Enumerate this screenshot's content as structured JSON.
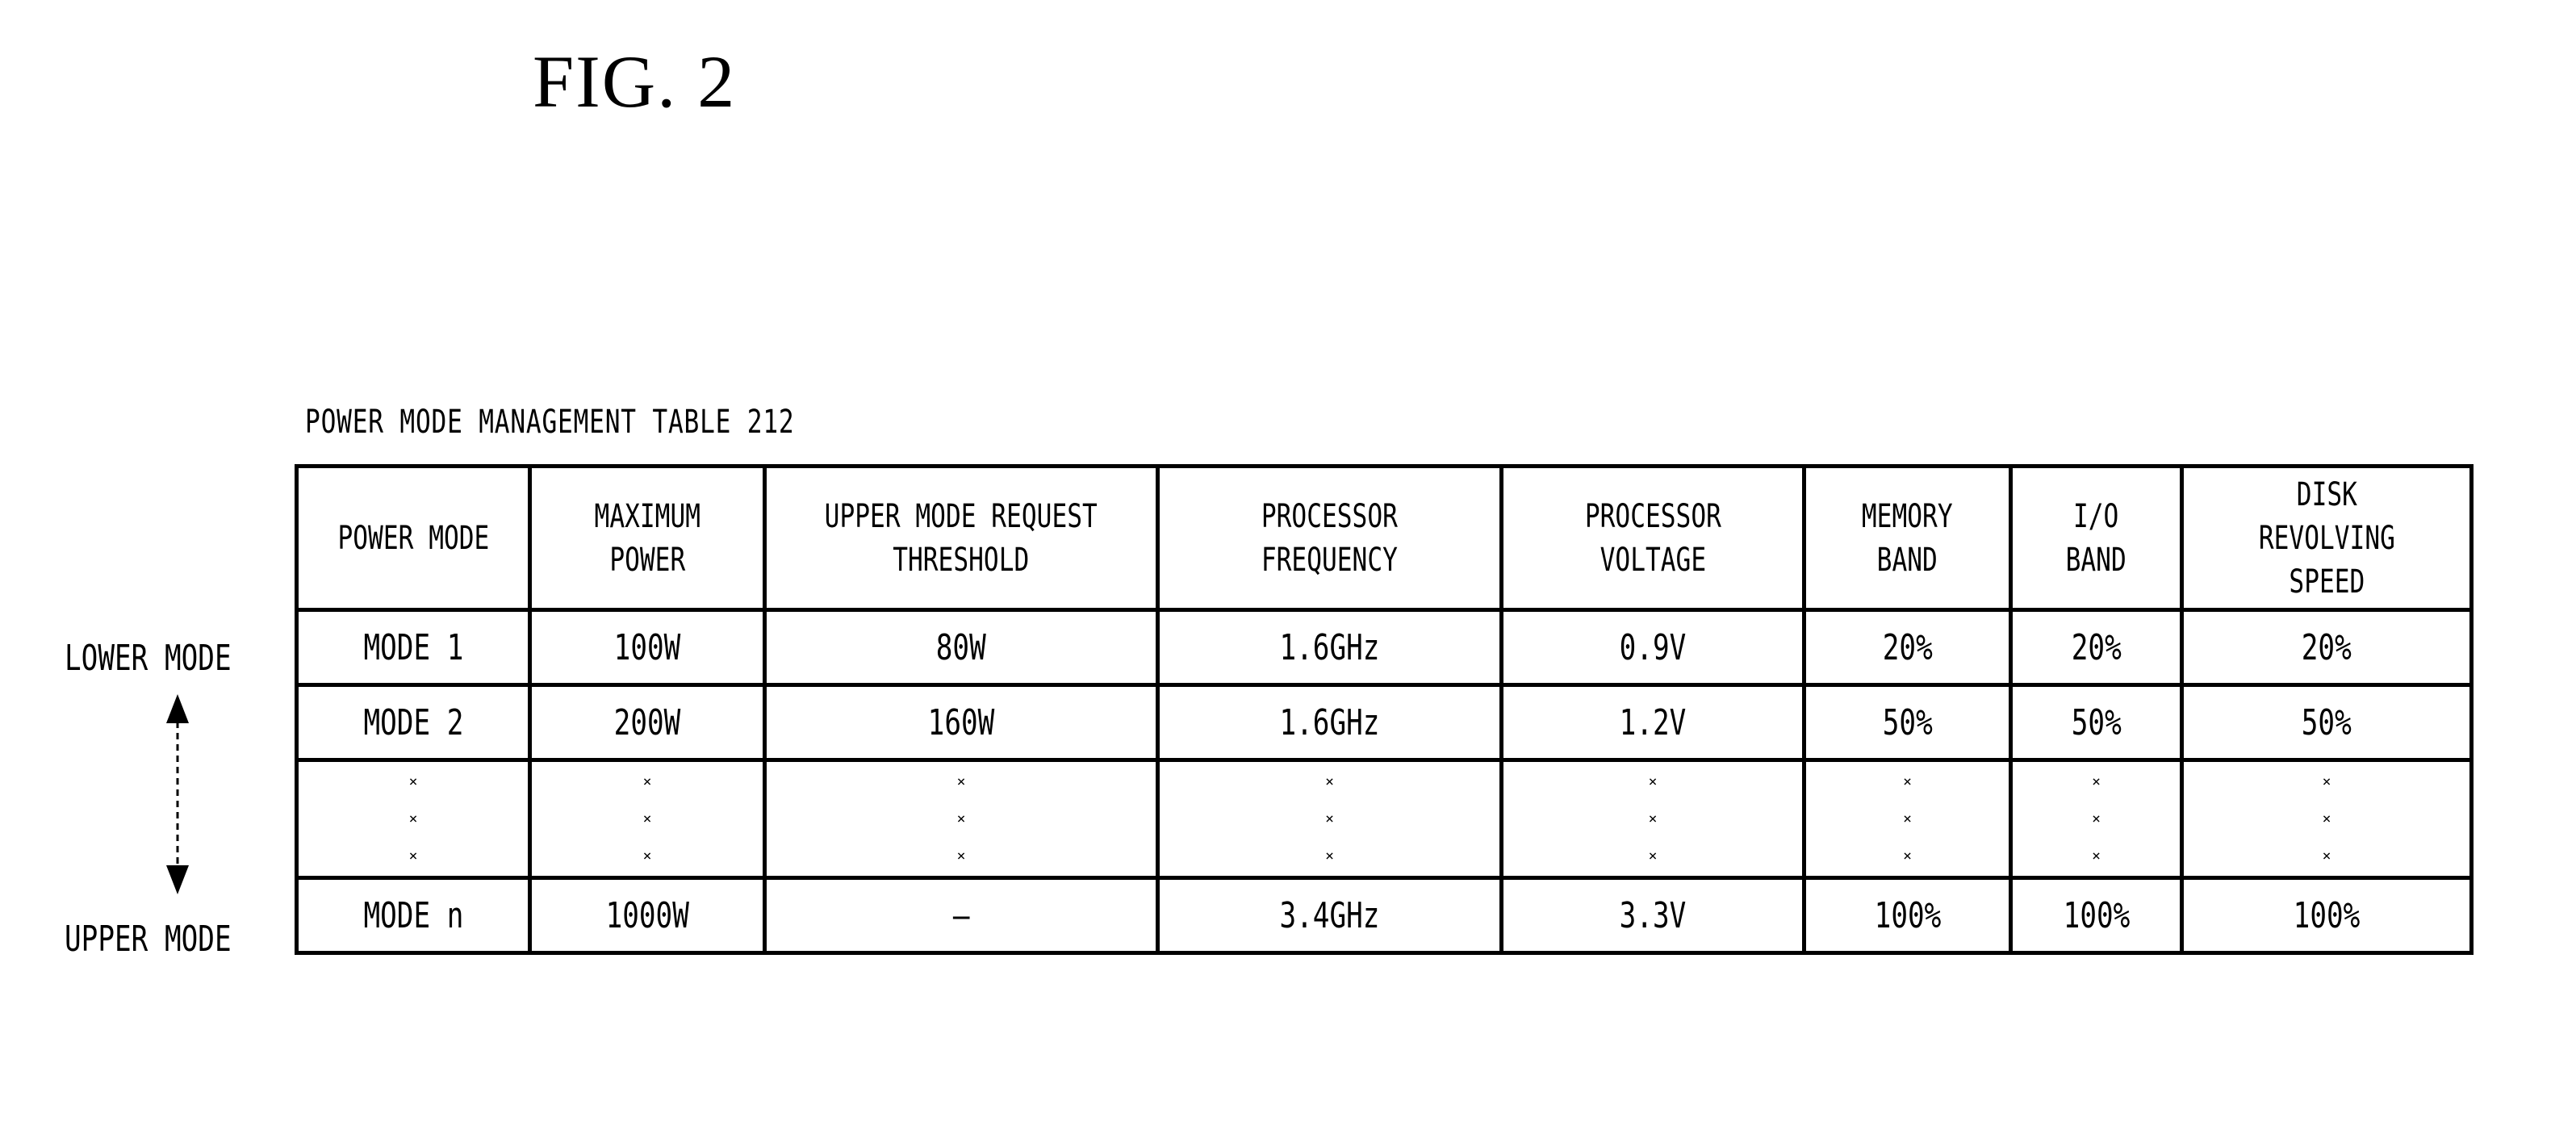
{
  "figure": {
    "title": "FIG. 2"
  },
  "table": {
    "caption": "POWER MODE MANAGEMENT TABLE 212",
    "columns": [
      "POWER MODE",
      "MAXIMUM\nPOWER",
      "UPPER MODE REQUEST\nTHRESHOLD",
      "PROCESSOR\nFREQUENCY",
      "PROCESSOR\nVOLTAGE",
      "MEMORY\nBAND",
      "I/O\nBAND",
      "DISK\nREVOLVING\nSPEED"
    ],
    "rows": [
      [
        "MODE 1",
        "100W",
        "80W",
        "1.6GHz",
        "0.9V",
        "20%",
        "20%",
        "20%"
      ],
      [
        "MODE 2",
        "200W",
        "160W",
        "1.6GHz",
        "1.2V",
        "50%",
        "50%",
        "50%"
      ],
      [
        "MODE n",
        "1000W",
        "—",
        "3.4GHz",
        "3.3V",
        "100%",
        "100%",
        "100%"
      ]
    ],
    "ellipsis_marker": "×"
  },
  "side_labels": {
    "lower": "LOWER MODE",
    "upper": "UPPER MODE",
    "arrow_icon": "double-headed-vertical-arrow"
  }
}
